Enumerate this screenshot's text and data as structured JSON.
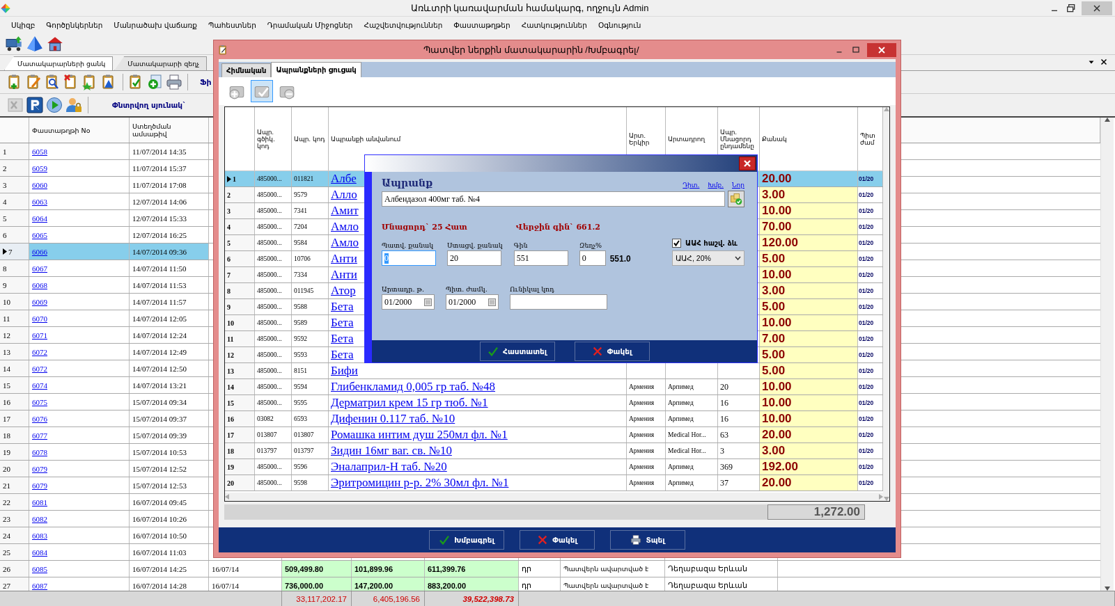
{
  "window": {
    "title": "Առևտրի կառավարման համակարգ, ողջույն Admin"
  },
  "menu": [
    "Սկիզբ",
    "Գործընկերներ",
    "Մանրածախ վաճառք",
    "Պահեստներ",
    "Դրամական Միջոցներ",
    "Հաշվետվություններ",
    "Փաստաթղթեր",
    "Հատկություններ",
    "Օգնություն"
  ],
  "tabs": [
    {
      "label": "Մատակարարների ցանկ",
      "selected": true
    },
    {
      "label": "Մատակարարի զեղչ",
      "selected": false
    }
  ],
  "toolbar_cut_label": "Ֆի",
  "search_column_label": "Փնտրվող սյունակ`",
  "documents": {
    "columns": [
      "Փաստաթղթի No",
      "Ստեղծման ամսաթիվ"
    ],
    "rows": [
      {
        "number": "1",
        "doc": "6058",
        "created": "11/07/2014 14:35",
        "selected": false
      },
      {
        "number": "2",
        "doc": "6059",
        "created": "11/07/2014 15:37",
        "selected": false
      },
      {
        "number": "3",
        "doc": "6060",
        "created": "11/07/2014 17:08",
        "selected": false
      },
      {
        "number": "4",
        "doc": "6063",
        "created": "12/07/2014 14:06",
        "selected": false
      },
      {
        "number": "5",
        "doc": "6064",
        "created": "12/07/2014 15:33",
        "selected": false
      },
      {
        "number": "6",
        "doc": "6065",
        "created": "12/07/2014 16:25",
        "selected": false
      },
      {
        "number": "7",
        "doc": "6066",
        "created": "14/07/2014 09:36",
        "selected": true
      },
      {
        "number": "8",
        "doc": "6067",
        "created": "14/07/2014 11:50",
        "selected": false
      },
      {
        "number": "9",
        "doc": "6068",
        "created": "14/07/2014 11:53",
        "selected": false
      },
      {
        "number": "10",
        "doc": "6069",
        "created": "14/07/2014 11:57",
        "selected": false
      },
      {
        "number": "11",
        "doc": "6070",
        "created": "14/07/2014 12:05",
        "selected": false
      },
      {
        "number": "12",
        "doc": "6071",
        "created": "14/07/2014 12:24",
        "selected": false
      },
      {
        "number": "13",
        "doc": "6072",
        "created": "14/07/2014 12:49",
        "selected": false
      },
      {
        "number": "14",
        "doc": "6072",
        "created": "14/07/2014 12:50",
        "selected": false
      },
      {
        "number": "15",
        "doc": "6074",
        "created": "14/07/2014 13:21",
        "selected": false
      },
      {
        "number": "16",
        "doc": "6075",
        "created": "15/07/2014 09:34",
        "selected": false
      },
      {
        "number": "17",
        "doc": "6076",
        "created": "15/07/2014 09:37",
        "selected": false
      },
      {
        "number": "18",
        "doc": "6077",
        "created": "15/07/2014 09:39",
        "selected": false
      },
      {
        "number": "19",
        "doc": "6078",
        "created": "15/07/2014 10:53",
        "selected": false
      },
      {
        "number": "20",
        "doc": "6079",
        "created": "15/07/2014 12:52",
        "selected": false
      },
      {
        "number": "21",
        "doc": "6079",
        "created": "15/07/2014 12:53",
        "selected": false
      },
      {
        "number": "22",
        "doc": "6081",
        "created": "16/07/2014 09:45",
        "selected": false
      },
      {
        "number": "23",
        "doc": "6082",
        "created": "16/07/2014 10:26",
        "selected": false
      },
      {
        "number": "24",
        "doc": "6083",
        "created": "16/07/2014 10:50",
        "selected": false
      },
      {
        "number": "25",
        "doc": "6084",
        "created": "16/07/2014 11:03",
        "selected": false
      },
      {
        "number": "26",
        "doc": "6085",
        "created": "16/07/2014 14:25",
        "selected": false,
        "order_date": "16/07/14",
        "amount": "509,499.80",
        "vat": "101,899.96",
        "total": "611,399.76",
        "currency": "դր",
        "status": "Պատվերն ավարտված է",
        "supplier": "Դեղաբազա Երևան"
      },
      {
        "number": "27",
        "doc": "6087",
        "created": "16/07/2014 14:28",
        "selected": false,
        "order_date": "16/07/14",
        "amount": "736,000.00",
        "vat": "147,200.00",
        "total": "883,200.00",
        "currency": "դր",
        "status": "Պատվերն ավարտված է",
        "supplier": "Դեղաբազա Երևան"
      }
    ],
    "totals": [
      "33,117,202.17",
      "6,405,196.56",
      "39,522,398.73"
    ]
  },
  "dialog": {
    "title": "Պատվեր ներքին մատակարարին /Խմբագրել/",
    "tabs": [
      {
        "label": "Հիմնական",
        "selected": false
      },
      {
        "label": "Ապրանքների ցուցակ",
        "selected": true
      }
    ],
    "toolbar": [
      {
        "kind": "add",
        "selected": false
      },
      {
        "kind": "edit",
        "selected": true
      },
      {
        "kind": "remove",
        "selected": false
      }
    ],
    "columns": [
      "Ապր. գծիկ. կոդ",
      "Ապր. կոդ",
      "Ապրանքի անվանում",
      "Արտ. Երկիր",
      "Արտադրող",
      "Ապր. Մնացորդ ընդամենը",
      "Քանակ",
      "Պիտ ժամ"
    ],
    "rows": [
      {
        "number": "1",
        "barcode": "485000...",
        "code": "011821",
        "name": "Албе",
        "qty": "20.00",
        "expiry": "01/20",
        "selected": true
      },
      {
        "number": "2",
        "barcode": "485000...",
        "code": "9579",
        "name": "Алло",
        "qty": "3.00",
        "expiry": "01/20",
        "selected": false
      },
      {
        "number": "3",
        "barcode": "485000...",
        "code": "7341",
        "name": "Амит",
        "qty": "10.00",
        "expiry": "01/20",
        "selected": false
      },
      {
        "number": "4",
        "barcode": "485000...",
        "code": "7204",
        "name": "Амло",
        "qty": "70.00",
        "expiry": "01/20",
        "selected": false
      },
      {
        "number": "5",
        "barcode": "485000...",
        "code": "9584",
        "name": "Амло",
        "qty": "120.00",
        "expiry": "01/20",
        "selected": false
      },
      {
        "number": "6",
        "barcode": "485000...",
        "code": "10706",
        "name": "Анти",
        "qty": "5.00",
        "expiry": "01/20",
        "selected": false
      },
      {
        "number": "7",
        "barcode": "485000...",
        "code": "7334",
        "name": "Анти",
        "qty": "10.00",
        "expiry": "01/20",
        "selected": false
      },
      {
        "number": "8",
        "barcode": "485000...",
        "code": "011945",
        "name": "Атор",
        "qty": "3.00",
        "expiry": "01/20",
        "selected": false
      },
      {
        "number": "9",
        "barcode": "485000...",
        "code": "9588",
        "name": "Бета",
        "qty": "5.00",
        "expiry": "01/20",
        "selected": false
      },
      {
        "number": "10",
        "barcode": "485000...",
        "code": "9589",
        "name": "Бета",
        "qty": "10.00",
        "expiry": "01/20",
        "selected": false
      },
      {
        "number": "11",
        "barcode": "485000...",
        "code": "9592",
        "name": "Бета",
        "qty": "7.00",
        "expiry": "01/20",
        "selected": false
      },
      {
        "number": "12",
        "barcode": "485000...",
        "code": "9593",
        "name": "Бета",
        "qty": "5.00",
        "expiry": "01/20",
        "selected": false
      },
      {
        "number": "13",
        "barcode": "485000...",
        "code": "8151",
        "name": "Бифи",
        "qty": "5.00",
        "expiry": "01/20",
        "selected": false
      },
      {
        "number": "14",
        "barcode": "485000...",
        "code": "9594",
        "name": "Глибенкламид 0,005 гр таб. №48",
        "country": "Армения",
        "producer": "Арпимед",
        "stock": "20",
        "qty": "10.00",
        "expiry": "01/20",
        "selected": false
      },
      {
        "number": "15",
        "barcode": "485000...",
        "code": "9595",
        "name": "Дерматрил крем 15 гр тюб. №1",
        "country": "Армения",
        "producer": "Арпимед",
        "stock": "16",
        "qty": "10.00",
        "expiry": "01/20",
        "selected": false
      },
      {
        "number": "16",
        "barcode": "03082",
        "code": "6593",
        "name": "Дифенин 0.117 таб. №10",
        "country": "Армения",
        "producer": "Арпимед",
        "stock": "16",
        "qty": "10.00",
        "expiry": "01/20",
        "selected": false
      },
      {
        "number": "17",
        "barcode": "013807",
        "code": "013807",
        "name": "Ромашка интим душ 250мл фл. №1",
        "country": "Армения",
        "producer": "Medical Hor...",
        "stock": "63",
        "qty": "20.00",
        "expiry": "01/20",
        "selected": false
      },
      {
        "number": "18",
        "barcode": "013797",
        "code": "013797",
        "name": "Зидин 16мг ваг. св. №10",
        "country": "Армения",
        "producer": "Medical Hor...",
        "stock": "3",
        "qty": "3.00",
        "expiry": "01/20",
        "selected": false
      },
      {
        "number": "19",
        "barcode": "485000...",
        "code": "9596",
        "name": "Эналаприл-Н таб. №20",
        "country": "Армения",
        "producer": "Арпимед",
        "stock": "369",
        "qty": "192.00",
        "expiry": "01/20",
        "selected": false
      },
      {
        "number": "20",
        "barcode": "485000...",
        "code": "9598",
        "name": "Эритромицин р-р. 2% 30мл фл. №1",
        "country": "Армения",
        "producer": "Арпимед",
        "stock": "37",
        "qty": "20.00",
        "expiry": "01/20",
        "selected": false
      }
    ],
    "total": "1,272.00",
    "buttons": [
      {
        "kind": "confirm",
        "label": "Խմբագրել"
      },
      {
        "kind": "cancel",
        "label": "Փակել"
      },
      {
        "kind": "print",
        "label": "Տպել"
      }
    ]
  },
  "popup": {
    "title": "Ապրանք",
    "links": [
      "Դիտ.",
      "Խմբ.",
      "Նոր"
    ],
    "product": "Албендазол 400мг таб. №4",
    "stock": "Մնացորդ` 25 Հատ",
    "last_price": "Վերջին գին` 661.2",
    "fields": [
      {
        "label": "Պատվ. քանակ",
        "value": "0",
        "focused": true
      },
      {
        "label": "Ստացվ. քանակ",
        "value": "20",
        "focused": false
      },
      {
        "label": "Գին",
        "value": "551",
        "focused": false
      },
      {
        "label": "Զեղչ%",
        "value": "0",
        "focused": false
      }
    ],
    "sum": "551.0",
    "vat": {
      "label": "ԱԱՀ հաշվ. ձև",
      "checked": true
    },
    "vat_rate": "ԱԱՀ, 20%",
    "dates": [
      {
        "label": "Արտադր. թ.",
        "value": "01/2000"
      },
      {
        "label": "Պիտ. ժամկ.",
        "value": "01/2000"
      }
    ],
    "unique_code": {
      "label": "Ունիկալ կոդ"
    },
    "buttons": [
      {
        "kind": "confirm",
        "label": "Հաստատել"
      },
      {
        "kind": "cancel",
        "label": "Փակել"
      }
    ]
  }
}
